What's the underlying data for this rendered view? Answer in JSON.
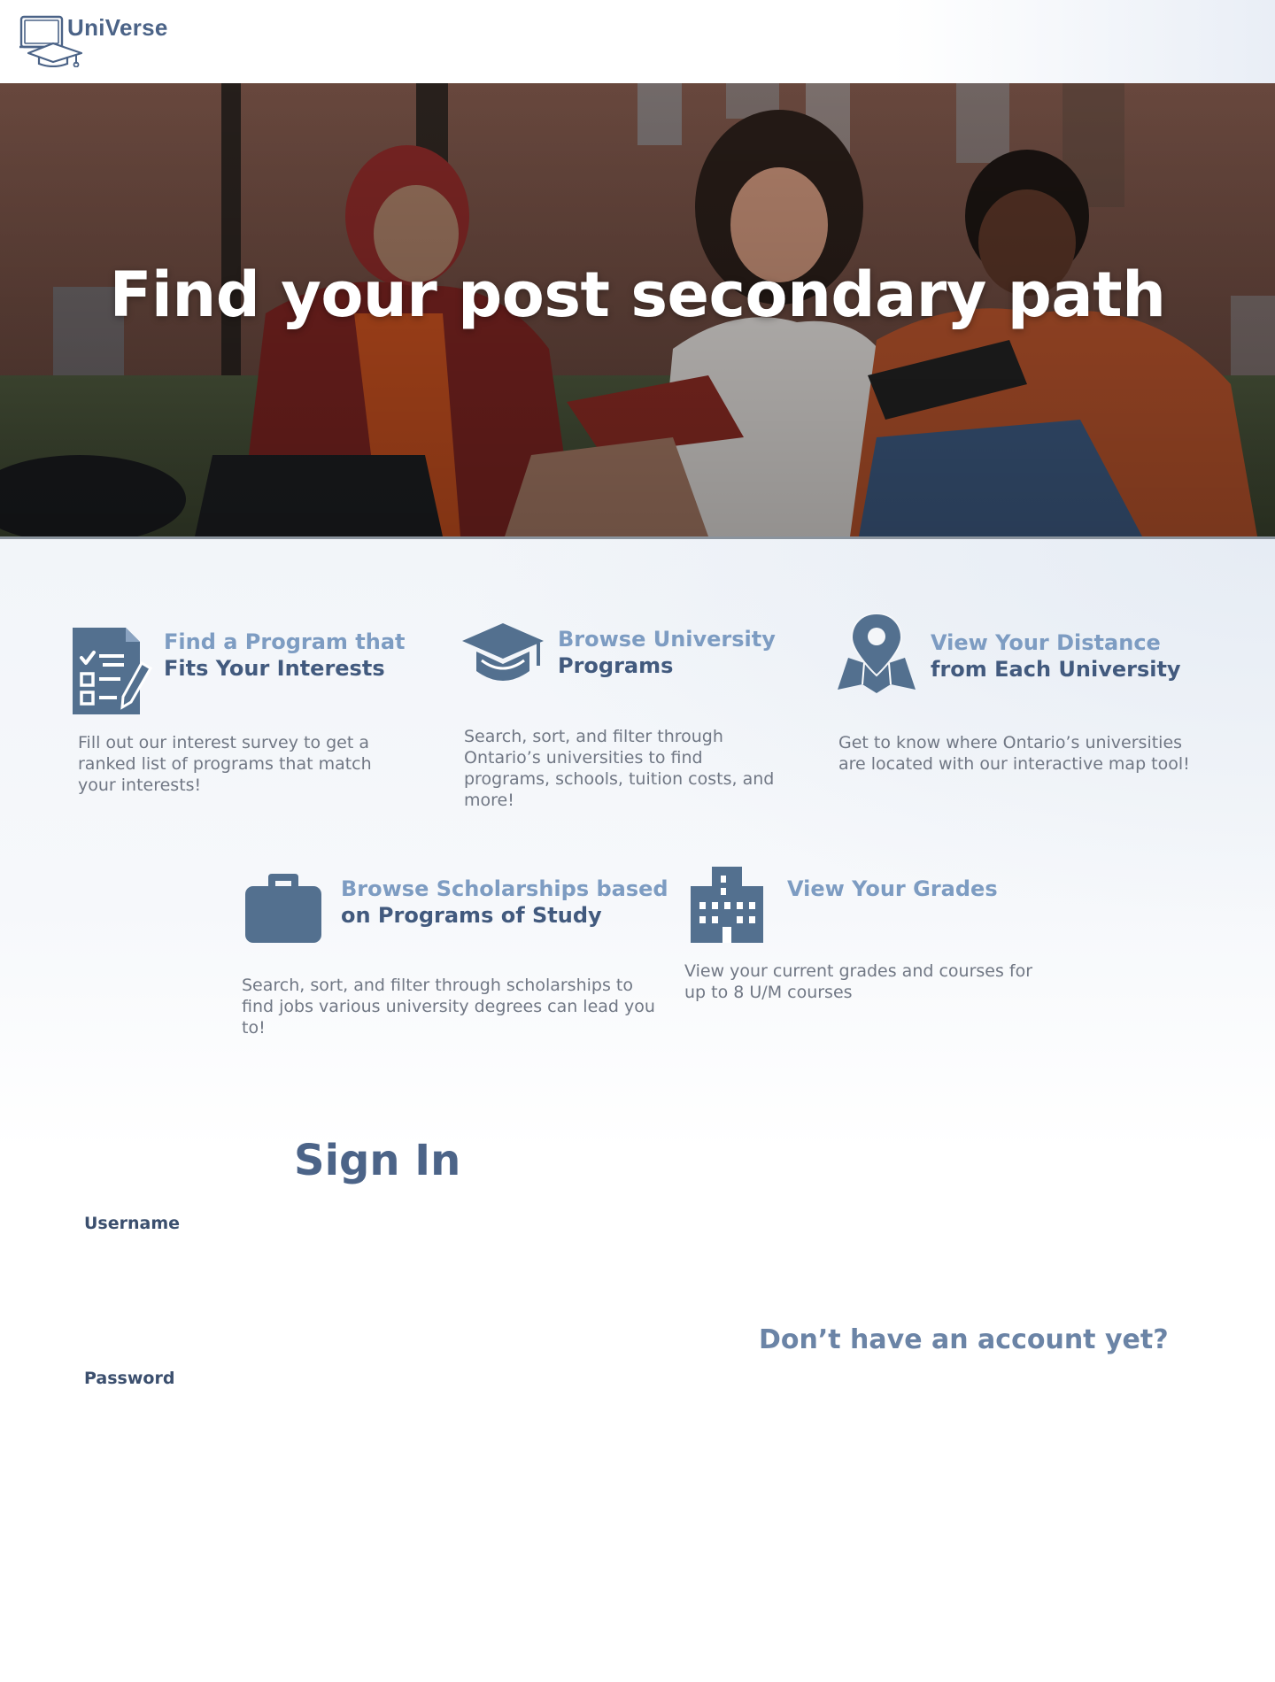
{
  "header": {
    "brand": "UniVerse",
    "logo_icon": "laptop-graduation-cap-icon"
  },
  "hero": {
    "title": "Find your post secondary path",
    "image": "students-studying-on-campus-lawn"
  },
  "features": [
    {
      "icon": "checklist-pencil-icon",
      "title_line1": "Find a Program that",
      "title_line2": "Fits Your Interests",
      "description": "Fill out our interest survey to get a ranked list of programs that match your interests!"
    },
    {
      "icon": "graduation-cap-icon",
      "title_line1": "Browse University",
      "title_line2": "Programs",
      "description": "Search, sort, and filter through Ontario’s universities to find programs, schools, tuition costs, and more!"
    },
    {
      "icon": "map-pin-icon",
      "title_line1": "View Your Distance",
      "title_line2": "from Each University",
      "description": "Get to know where Ontario’s universities are located with our interactive map tool!"
    },
    {
      "icon": "briefcase-icon",
      "title_line1": "Browse Scholarships based",
      "title_line2": "on Programs of Study",
      "description": "Search, sort, and filter through scholarships to find jobs various university degrees can lead you to!"
    },
    {
      "icon": "building-icon",
      "title_line1": "View Your Grades",
      "title_line2": "",
      "description": "View your current grades and courses for up to 8 U/M courses"
    }
  ],
  "signin": {
    "title": "Sign In",
    "username_label": "Username",
    "username_value": "",
    "password_label": "Password",
    "password_value": ""
  },
  "register": {
    "prompt": "Don’t have an account yet?"
  },
  "colors": {
    "accent_light": "#7d9cc2",
    "accent_dark": "#425a7e",
    "icon_fill": "#53708f",
    "body_text": "#707784"
  }
}
